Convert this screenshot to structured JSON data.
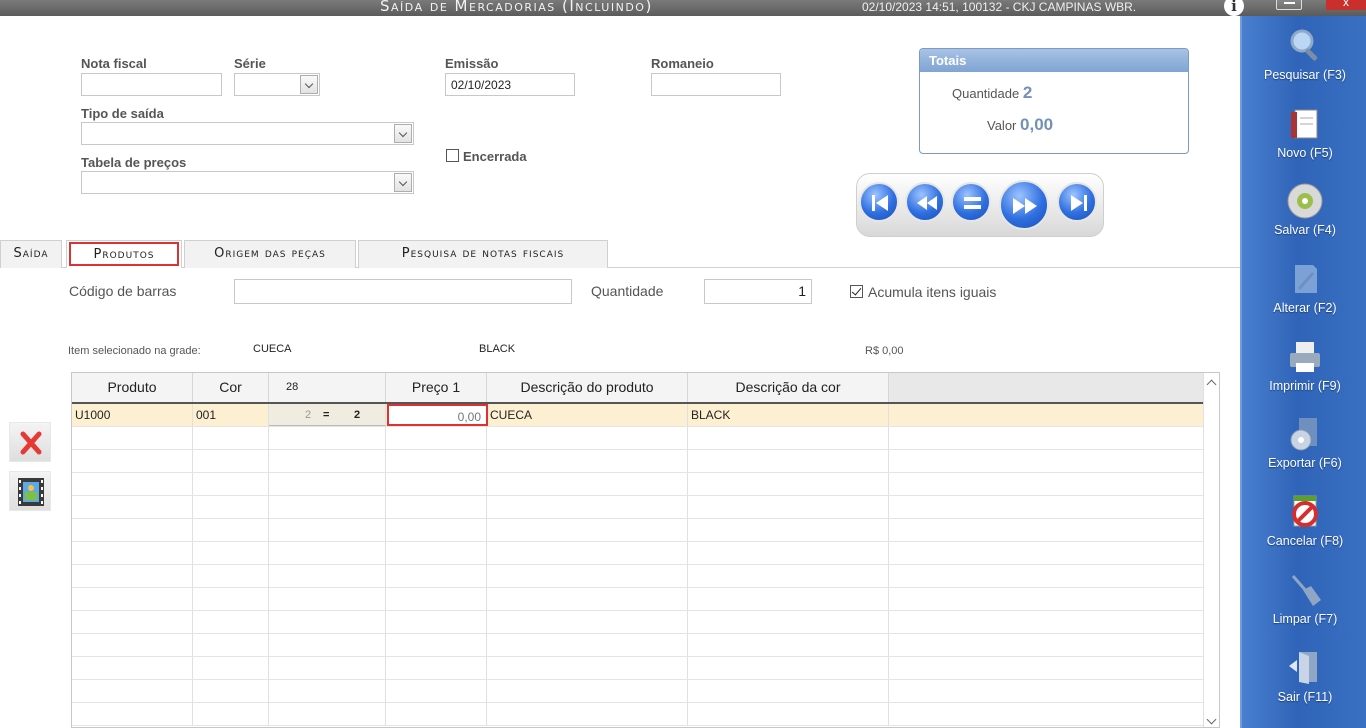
{
  "window": {
    "title": "Saída de Mercadorias (Incluindo)",
    "status": "02/10/2023 14:51, 100132 - CKJ CAMPINAS WBR.",
    "close_label": "x"
  },
  "form": {
    "nota_fiscal_label": "Nota fiscal",
    "nota_fiscal_value": "",
    "serie_label": "Série",
    "serie_value": "",
    "emissao_label": "Emissão",
    "emissao_value": "02/10/2023",
    "romaneio_label": "Romaneio",
    "romaneio_value": "",
    "tipo_saida_label": "Tipo de saída",
    "tipo_saida_value": "",
    "tabela_precos_label": "Tabela de preços",
    "tabela_precos_value": "",
    "encerrada_label": "Encerrada",
    "encerrada_checked": false
  },
  "totais": {
    "title": "Totais",
    "quantidade_label": "Quantidade",
    "quantidade_value": "2",
    "valor_label": "Valor",
    "valor_value": "0,00"
  },
  "nav": {
    "icons": [
      "first-icon",
      "previous-icon",
      "equal-icon",
      "next-icon",
      "last-icon"
    ]
  },
  "tabs": [
    {
      "label": "Saída",
      "active": false
    },
    {
      "label": "Produtos",
      "active": true
    },
    {
      "label": "Origem das peças",
      "active": false
    },
    {
      "label": "Pesquisa de notas fiscais",
      "active": false
    }
  ],
  "barcode": {
    "codigo_label": "Código de barras",
    "codigo_value": "",
    "quantidade_label": "Quantidade",
    "quantidade_value": "1",
    "acumula_label": "Acumula itens iguais",
    "acumula_checked": true
  },
  "selected": {
    "label": "Item selecionado na grade:",
    "produto": "CUECA",
    "cor": "BLACK",
    "preco": "R$ 0,00"
  },
  "grid": {
    "columns": [
      "Produto",
      "Cor",
      "28",
      "Preço 1",
      "Descrição do produto",
      "Descrição da cor"
    ],
    "rows": [
      {
        "produto": "U1000",
        "cor": "001",
        "qtd": "2",
        "eq": "=",
        "total": "2",
        "preco": "0,00",
        "descricao_produto": "CUECA",
        "descricao_cor": "BLACK"
      }
    ]
  },
  "sidebar": {
    "items": [
      {
        "label": "Pesquisar (F3)",
        "icon": "search-icon"
      },
      {
        "label": "Novo (F5)",
        "icon": "new-document-icon"
      },
      {
        "label": "Salvar (F4)",
        "icon": "save-disc-icon"
      },
      {
        "label": "Alterar (F2)",
        "icon": "edit-icon"
      },
      {
        "label": "Imprimir (F9)",
        "icon": "printer-icon"
      },
      {
        "label": "Exportar (F6)",
        "icon": "export-icon"
      },
      {
        "label": "Cancelar (F8)",
        "icon": "cancel-icon"
      },
      {
        "label": "Limpar (F7)",
        "icon": "broom-icon"
      },
      {
        "label": "Sair (F11)",
        "icon": "exit-door-icon"
      }
    ]
  },
  "colors": {
    "sidebar": "#2f64b8",
    "selected_row": "#fdf0d2",
    "highlight": "#e03030",
    "totals_value": "#7390b8"
  }
}
